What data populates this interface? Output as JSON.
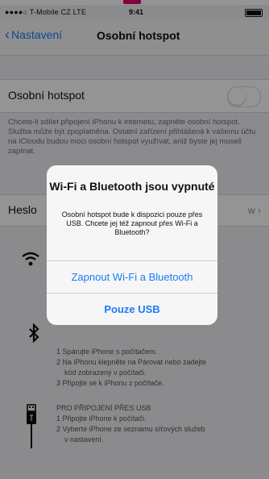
{
  "status": {
    "carrier": "●●●●○ T-Mobile CZ  LTE",
    "time": "9:41"
  },
  "nav": {
    "back_label": "Nastavení",
    "title": "Osobní hotspot"
  },
  "hotspot_row": {
    "label": "Osobní hotspot"
  },
  "description": "Chcete-li sdílet připojení iPhonu k internetu, zapněte osobní hotspot. Služba může být zpoplatněna. Ostatní zařízení přihlášená k vašemu účtu na iCloudu budou moci osobní hotspot využívat, aniž byste jej museli zapínat.",
  "password_row": {
    "label": "Heslo",
    "value": "w"
  },
  "bluetooth_steps": [
    "1 Spárujte iPhone s počítačem.",
    "2 Na iPhonu klepněte na Párovat nebo zadejte",
    "kód zobrazený v počítači.",
    "3 Připojte se k iPhonu z počítače."
  ],
  "usb_steps": [
    "PRO PŘIPOJENÍ PŘES USB",
    "1 Připojte iPhone k počítači.",
    "2 Vyberte iPhone ze seznamu síťových služeb",
    "v nastavení."
  ],
  "alert": {
    "title": "Wi-Fi a Bluetooth jsou vypnuté",
    "message": "Osobní hotspot bude k dispozici pouze přes USB. Chcete jej též zapnout přes Wi-Fi a Bluetooth?",
    "primary_button": "Zapnout Wi-Fi a Bluetooth",
    "secondary_button": "Pouze USB"
  }
}
